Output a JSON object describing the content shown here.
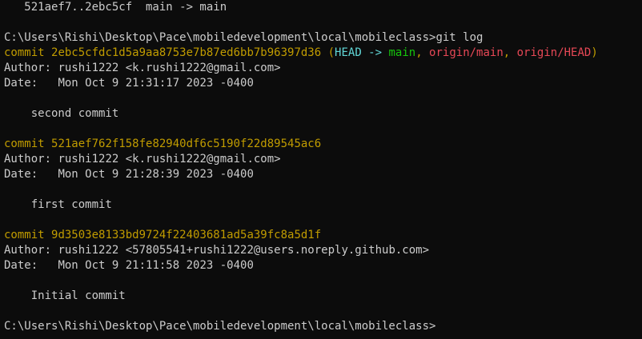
{
  "colors": {
    "background": "#0c0c0c",
    "foreground": "#cccccc",
    "commit_yellow": "#c19c00",
    "head_cyan": "#61d6d6",
    "branch_green": "#16c60c",
    "remote_red": "#e74856"
  },
  "push_result": "   521aef7..2ebc5cf  main -> main",
  "prompt": {
    "path": "C:\\Users\\Rishi\\Desktop\\Pace\\mobiledevelopment\\local\\mobileclass>",
    "command": "git log"
  },
  "deco": {
    "open": " (",
    "close": ")",
    "arrow": " -> ",
    "sep": ", "
  },
  "commits": [
    {
      "keyword": "commit",
      "hash": "2ebc5cfdc1d5a9aa8753e7b87ed6bb7b96397d36",
      "head": "HEAD",
      "branch": "main",
      "remote1": "origin/main",
      "remote2": "origin/HEAD",
      "author_label": "Author: ",
      "author": "rushi1222 <k.rushi1222@gmail.com>",
      "date_label": "Date:   ",
      "date": "Mon Oct 9 21:31:17 2023 -0400",
      "message": "    second commit"
    },
    {
      "keyword": "commit",
      "hash": "521aef762f158fe82940df6c5190f22d89545ac6",
      "author_label": "Author: ",
      "author": "rushi1222 <k.rushi1222@gmail.com>",
      "date_label": "Date:   ",
      "date": "Mon Oct 9 21:28:39 2023 -0400",
      "message": "    first commit"
    },
    {
      "keyword": "commit",
      "hash": "9d3503e8133bd9724f22403681ad5a39fc8a5d1f",
      "author_label": "Author: ",
      "author": "rushi1222 <57805541+rushi1222@users.noreply.github.com>",
      "date_label": "Date:   ",
      "date": "Mon Oct 9 21:11:58 2023 -0400",
      "message": "    Initial commit"
    }
  ],
  "final_prompt": "C:\\Users\\Rishi\\Desktop\\Pace\\mobiledevelopment\\local\\mobileclass>"
}
